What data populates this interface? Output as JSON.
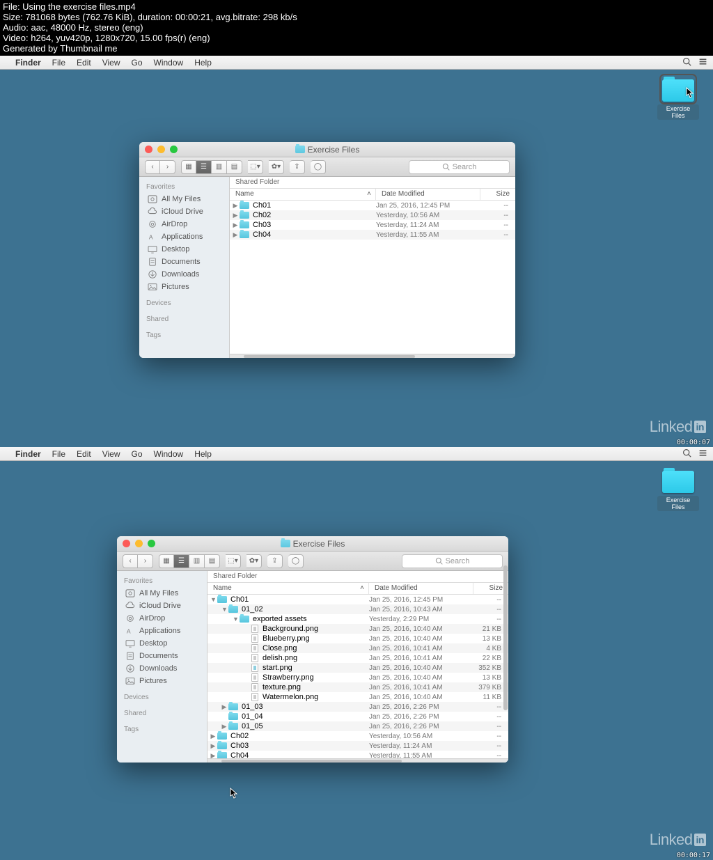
{
  "meta": {
    "file_line": "File: Using the exercise files.mp4",
    "size_line": "Size: 781068 bytes (762.76 KiB), duration: 00:00:21, avg.bitrate: 298 kb/s",
    "audio_line": "Audio: aac, 48000 Hz, stereo (eng)",
    "video_line": "Video: h264, yuv420p, 1280x720, 15.00 fps(r) (eng)",
    "gen_line": "Generated by Thumbnail me"
  },
  "linkedin": "Linked",
  "linkedin_in": "in",
  "desktop_icon_label": "Exercise Files",
  "menubar": {
    "app": "Finder",
    "items": [
      "File",
      "Edit",
      "View",
      "Go",
      "Window",
      "Help"
    ]
  },
  "finder": {
    "title": "Exercise Files",
    "pathbar": "Shared Folder",
    "search_placeholder": "Search",
    "cols": {
      "name": "Name",
      "date": "Date Modified",
      "size": "Size"
    },
    "sidebar": {
      "favorites_label": "Favorites",
      "devices_label": "Devices",
      "shared_label": "Shared",
      "tags_label": "Tags",
      "items": [
        {
          "icon": "all",
          "label": "All My Files"
        },
        {
          "icon": "cloud",
          "label": "iCloud Drive"
        },
        {
          "icon": "airdrop",
          "label": "AirDrop"
        },
        {
          "icon": "apps",
          "label": "Applications"
        },
        {
          "icon": "desktop",
          "label": "Desktop"
        },
        {
          "icon": "docs",
          "label": "Documents"
        },
        {
          "icon": "down",
          "label": "Downloads"
        },
        {
          "icon": "pics",
          "label": "Pictures"
        }
      ]
    }
  },
  "screens": [
    {
      "timecode": "00:00:07",
      "rows": [
        {
          "indent": 0,
          "icon": "folder",
          "disc": "▶",
          "name": "Ch01",
          "date": "Jan 25, 2016, 12:45 PM",
          "size": "--"
        },
        {
          "indent": 0,
          "icon": "folder",
          "disc": "▶",
          "name": "Ch02",
          "date": "Yesterday, 10:56 AM",
          "size": "--"
        },
        {
          "indent": 0,
          "icon": "folder",
          "disc": "▶",
          "name": "Ch03",
          "date": "Yesterday, 11:24 AM",
          "size": "--"
        },
        {
          "indent": 0,
          "icon": "folder",
          "disc": "▶",
          "name": "Ch04",
          "date": "Yesterday, 11:55 AM",
          "size": "--"
        }
      ]
    },
    {
      "timecode": "00:00:17",
      "rows": [
        {
          "indent": 0,
          "icon": "folder",
          "disc": "▼",
          "name": "Ch01",
          "date": "Jan 25, 2016, 12:45 PM",
          "size": "--"
        },
        {
          "indent": 1,
          "icon": "folder",
          "disc": "▼",
          "name": "01_02",
          "date": "Jan 25, 2016, 10:43 AM",
          "size": "--"
        },
        {
          "indent": 2,
          "icon": "folder",
          "disc": "▼",
          "name": "exported assets",
          "date": "Yesterday, 2:29 PM",
          "size": "--"
        },
        {
          "indent": 3,
          "icon": "file",
          "disc": "",
          "name": "Background.png",
          "date": "Jan 25, 2016, 10:40 AM",
          "size": "21 KB"
        },
        {
          "indent": 3,
          "icon": "file",
          "disc": "",
          "name": "Blueberry.png",
          "date": "Jan 25, 2016, 10:40 AM",
          "size": "13 KB"
        },
        {
          "indent": 3,
          "icon": "file",
          "disc": "",
          "name": "Close.png",
          "date": "Jan 25, 2016, 10:41 AM",
          "size": "4 KB"
        },
        {
          "indent": 3,
          "icon": "file",
          "disc": "",
          "name": "delish.png",
          "date": "Jan 25, 2016, 10:41 AM",
          "size": "22 KB"
        },
        {
          "indent": 3,
          "icon": "file2",
          "disc": "",
          "name": "start.png",
          "date": "Jan 25, 2016, 10:40 AM",
          "size": "352 KB"
        },
        {
          "indent": 3,
          "icon": "file",
          "disc": "",
          "name": "Strawberry.png",
          "date": "Jan 25, 2016, 10:40 AM",
          "size": "13 KB"
        },
        {
          "indent": 3,
          "icon": "file",
          "disc": "",
          "name": "texture.png",
          "date": "Jan 25, 2016, 10:41 AM",
          "size": "379 KB"
        },
        {
          "indent": 3,
          "icon": "file",
          "disc": "",
          "name": "Watermelon.png",
          "date": "Jan 25, 2016, 10:40 AM",
          "size": "11 KB"
        },
        {
          "indent": 1,
          "icon": "folder",
          "disc": "▶",
          "name": "01_03",
          "date": "Jan 25, 2016, 2:26 PM",
          "size": "--"
        },
        {
          "indent": 1,
          "icon": "folder",
          "disc": "",
          "name": "01_04",
          "date": "Jan 25, 2016, 2:26 PM",
          "size": "--"
        },
        {
          "indent": 1,
          "icon": "folder",
          "disc": "▶",
          "name": "01_05",
          "date": "Jan 25, 2016, 2:26 PM",
          "size": "--"
        },
        {
          "indent": 0,
          "icon": "folder",
          "disc": "▶",
          "name": "Ch02",
          "date": "Yesterday, 10:56 AM",
          "size": "--"
        },
        {
          "indent": 0,
          "icon": "folder",
          "disc": "▶",
          "name": "Ch03",
          "date": "Yesterday, 11:24 AM",
          "size": "--"
        },
        {
          "indent": 0,
          "icon": "folder",
          "disc": "▶",
          "name": "Ch04",
          "date": "Yesterday, 11:55 AM",
          "size": "--"
        }
      ]
    }
  ]
}
